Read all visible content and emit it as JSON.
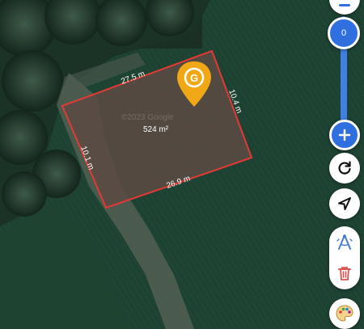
{
  "measurement": {
    "area": "524 m²",
    "edges": {
      "top": "27.5 m",
      "right": "10.4 m",
      "bottom": "26.9 m",
      "left": "10.1 m"
    },
    "watermark": "©2023 Google",
    "outline_color": "#e53935",
    "fill_color": "#5c4a43"
  },
  "marker": {
    "icon": "location-pin-icon",
    "glyph": "G",
    "color": "#f0a817"
  },
  "zoom": {
    "value": "0",
    "track_color": "#3f7fe8"
  },
  "toolbar": {
    "zoom_out_icon": "minus-icon",
    "zoom_in_icon": "plus-icon",
    "refresh_icon": "refresh-icon",
    "locate_icon": "navigation-arrow-icon",
    "draw_icon": "draw-compass-icon",
    "delete_icon": "trash-icon",
    "palette_icon": "palette-icon"
  }
}
